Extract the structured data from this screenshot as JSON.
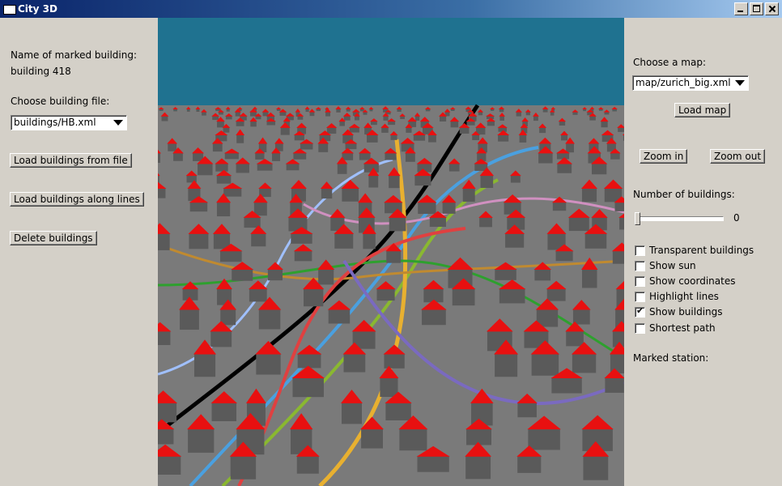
{
  "window": {
    "title": "City 3D"
  },
  "left": {
    "marked_label": "Name of marked building:",
    "marked_value": "building 418",
    "choose_file_label": "Choose building file:",
    "file_select_value": "buildings/HB.xml",
    "load_file_button": "Load buildings from file",
    "load_lines_button": "Load buildings along lines",
    "delete_button": "Delete buildings"
  },
  "right": {
    "choose_map_label": "Choose a map:",
    "map_select_value": "map/zurich_big.xml",
    "load_map_button": "Load map",
    "zoom_in_button": "Zoom in",
    "zoom_out_button": "Zoom out",
    "num_buildings_label": "Number of buildings:",
    "num_buildings_value": "0",
    "num_buildings_slider": 0,
    "checkboxes": [
      {
        "label": "Transparent buildings",
        "checked": false
      },
      {
        "label": "Show sun",
        "checked": false
      },
      {
        "label": "Show coordinates",
        "checked": false
      },
      {
        "label": "Highlight lines",
        "checked": false
      },
      {
        "label": "Show buildings",
        "checked": true
      },
      {
        "label": "Shortest path",
        "checked": false
      }
    ],
    "marked_station_label": "Marked station:"
  },
  "colors": {
    "sky": "#1f7290",
    "ground": "#7a7a7a",
    "roof": "#e81010",
    "wall": "#5a5a5a",
    "lines": [
      "#000000",
      "#4aa0e0",
      "#8ab830",
      "#e8b030",
      "#c08a30",
      "#2ea02e",
      "#e04040",
      "#a0c0ff",
      "#7a6ac0",
      "#d090c0"
    ]
  }
}
